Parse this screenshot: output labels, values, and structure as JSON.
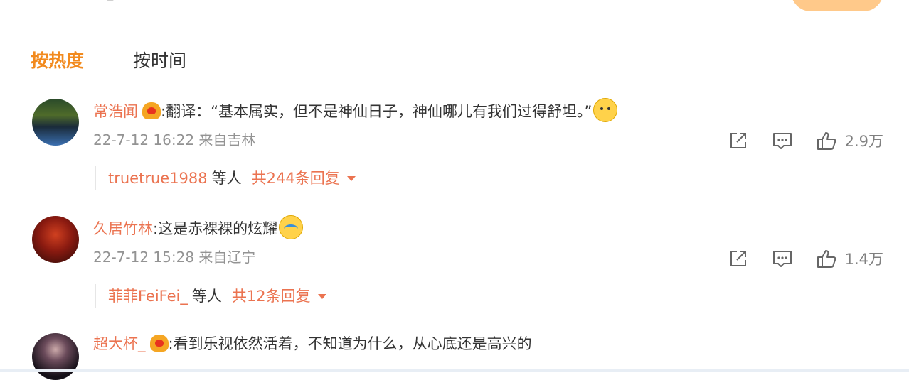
{
  "sort_tabs": {
    "hot": "按热度",
    "time": "按时间"
  },
  "comments": [
    {
      "user": "常浩闻",
      "colon": ":",
      "text": "翻译：“基本属实，但不是神仙日子，神仙哪儿有我们过得舒坦。”",
      "emoji": "dog-emoji",
      "meta": "22-7-12 16:22 来自吉林",
      "likes": "2.9万",
      "reply_users": "truetrue1988",
      "reply_etc": "等人",
      "reply_total": "共244条回复"
    },
    {
      "user": "久居竹林",
      "colon": ":",
      "text": "这是赤裸裸的炫耀",
      "emoji": "crying-emoji",
      "meta": "22-7-12 15:28 来自辽宁",
      "likes": "1.4万",
      "reply_users": "菲菲FeiFei_",
      "reply_etc": "等人",
      "reply_total": "共12条回复"
    },
    {
      "user": "超大杯_",
      "colon": ":",
      "text": "看到乐视依然活着，不知道为什么，从心底还是高兴的"
    }
  ],
  "colors": {
    "accent": "#f28a1e",
    "username": "#eb7350",
    "meta": "#939393"
  }
}
